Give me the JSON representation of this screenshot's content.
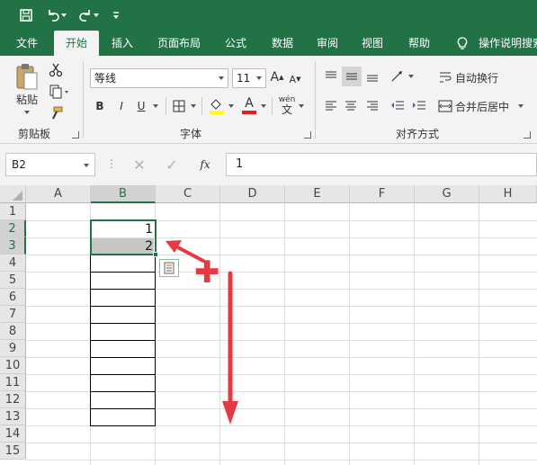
{
  "quick_access": {
    "save_icon": "save-icon",
    "undo_icon": "undo-icon",
    "redo_icon": "redo-icon",
    "customize_icon": "customize-qat-icon"
  },
  "tabs": [
    "文件",
    "开始",
    "插入",
    "页面布局",
    "公式",
    "数据",
    "审阅",
    "视图",
    "帮助"
  ],
  "active_tab": "开始",
  "tell_me": "操作说明搜索",
  "ribbon": {
    "clipboard": {
      "paste_label": "粘贴",
      "group_label": "剪贴板"
    },
    "font": {
      "font_name": "等线",
      "font_size": "11",
      "bold": "B",
      "italic": "I",
      "underline": "U",
      "font_color_letter": "A",
      "phonetic_label": "wén",
      "group_label": "字体"
    },
    "alignment": {
      "wrap_text": "自动换行",
      "merge_center": "合并后居中",
      "group_label": "对齐方式"
    }
  },
  "formula_bar": {
    "name_box": "B2",
    "fx_label": "fx",
    "value": "1"
  },
  "columns": [
    "A",
    "B",
    "C",
    "D",
    "E",
    "F",
    "G",
    "H"
  ],
  "selected_column": "B",
  "rows": [
    "1",
    "2",
    "3",
    "4",
    "5",
    "6",
    "7",
    "8",
    "9",
    "10",
    "11",
    "12",
    "13",
    "14",
    "15"
  ],
  "selected_rows": [
    "2",
    "3"
  ],
  "cells": {
    "B2": "1",
    "B3": "2"
  },
  "colors": {
    "excel_green": "#217346",
    "selection_gray": "#c6c6c6",
    "annotation_red": "#e53a43"
  }
}
